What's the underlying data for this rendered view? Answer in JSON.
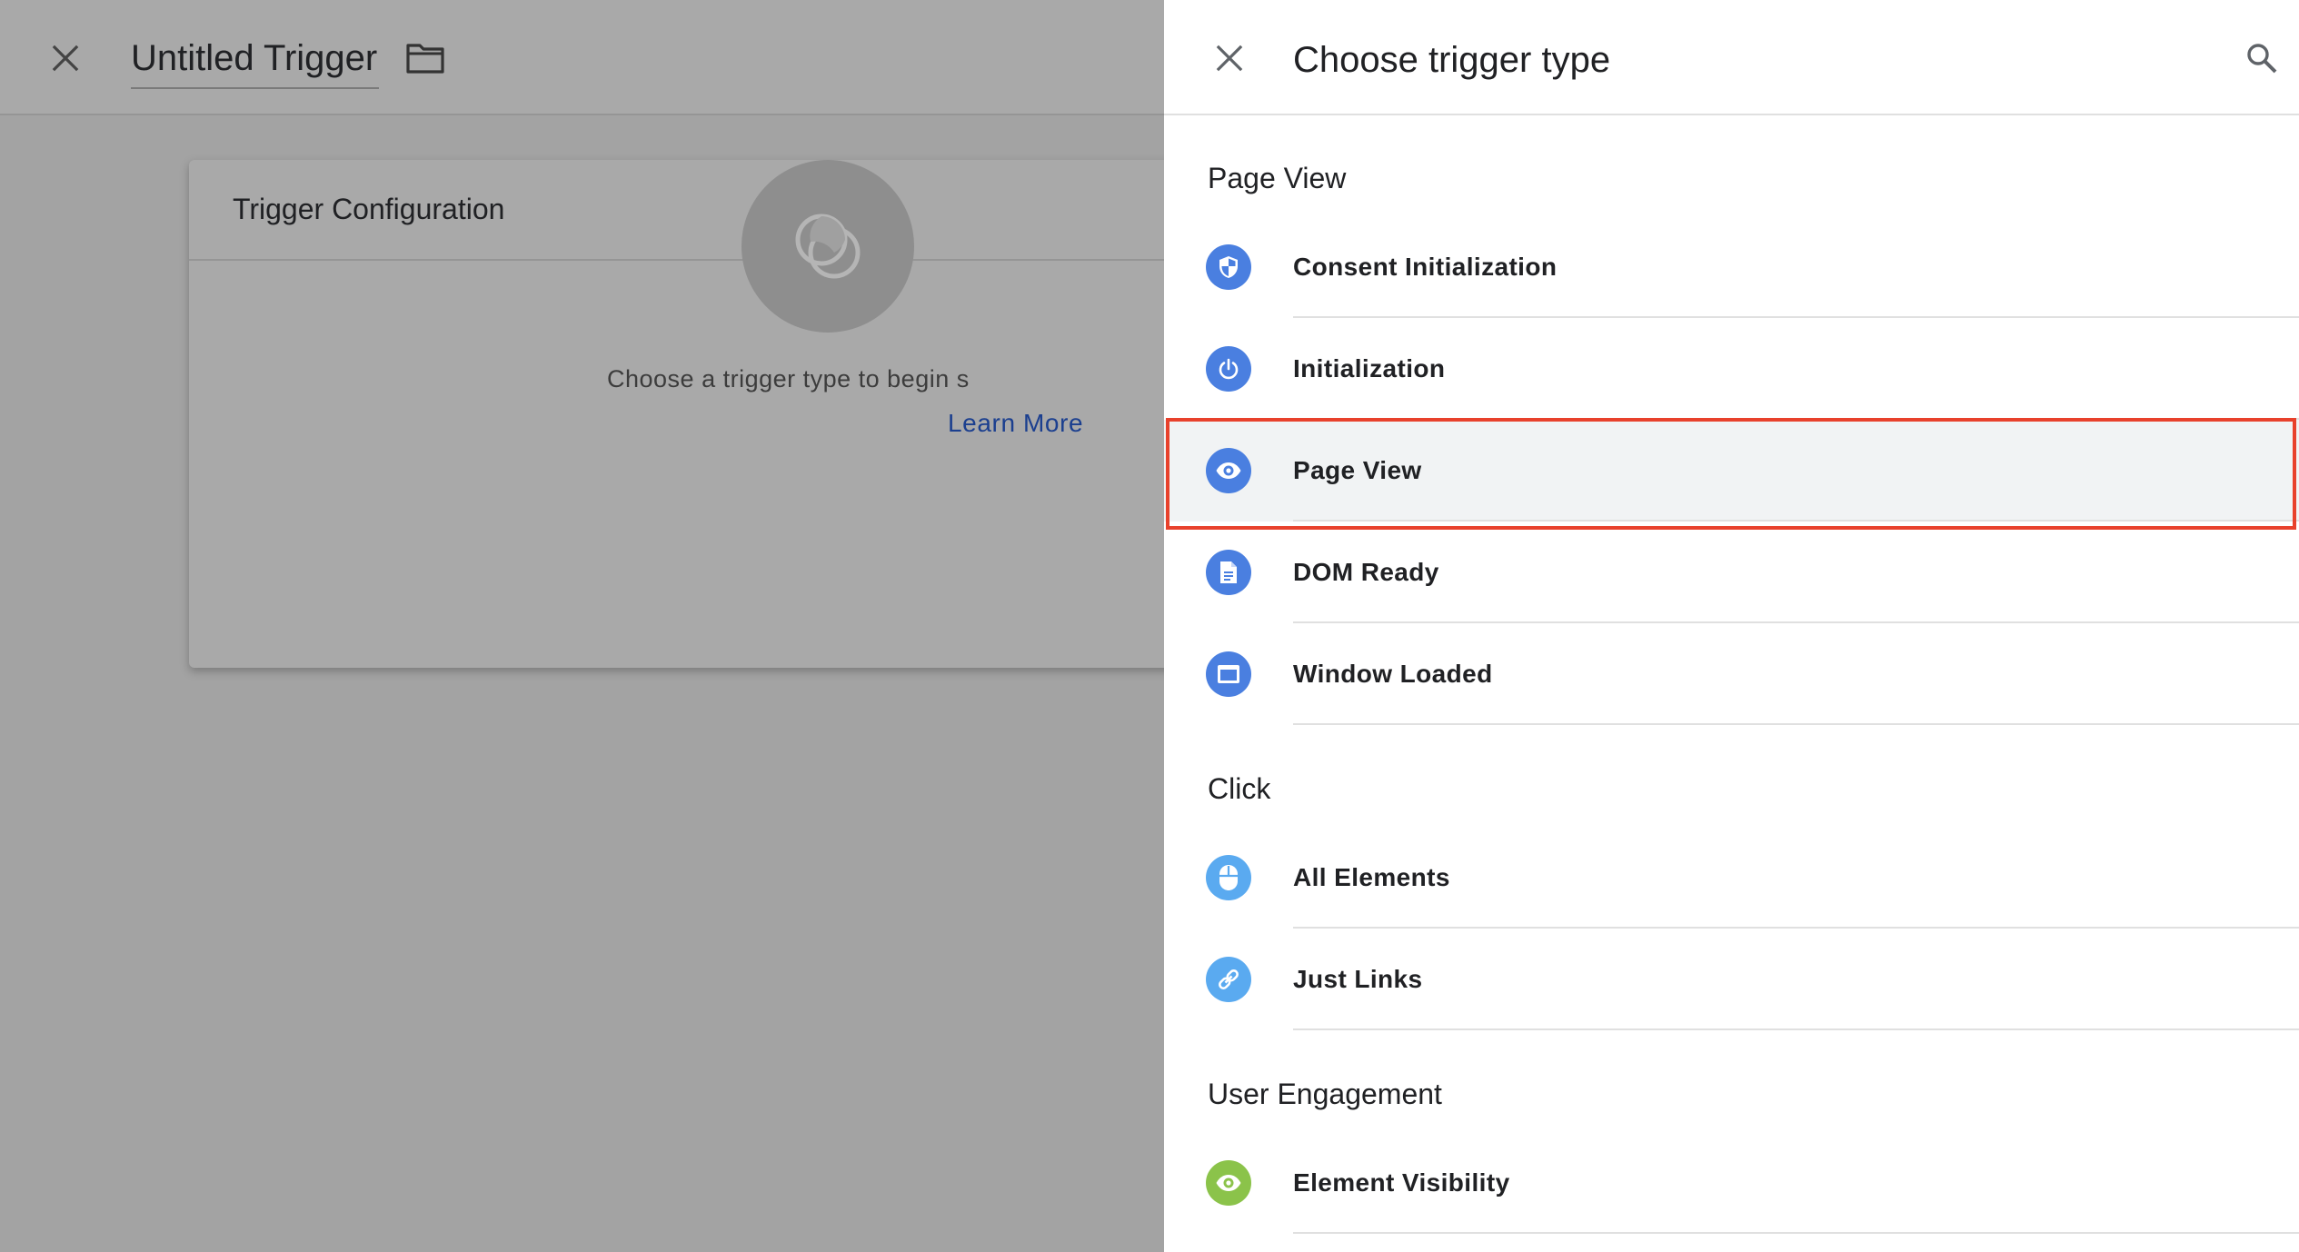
{
  "editor": {
    "title": "Untitled Trigger",
    "card_title": "Trigger Configuration",
    "hint": "Choose a trigger type to begin s",
    "learn_more": "Learn More"
  },
  "panel": {
    "title": "Choose trigger type",
    "sections": [
      {
        "title": "Page View",
        "items": [
          {
            "label": "Consent Initialization",
            "icon": "shield-icon"
          },
          {
            "label": "Initialization",
            "icon": "power-icon"
          },
          {
            "label": "Page View",
            "icon": "eye-icon",
            "selected": true
          },
          {
            "label": "DOM Ready",
            "icon": "document-icon"
          },
          {
            "label": "Window Loaded",
            "icon": "window-icon"
          }
        ]
      },
      {
        "title": "Click",
        "items": [
          {
            "label": "All Elements",
            "icon": "mouse-icon"
          },
          {
            "label": "Just Links",
            "icon": "link-icon"
          }
        ]
      },
      {
        "title": "User Engagement",
        "items": [
          {
            "label": "Element Visibility",
            "icon": "eye-icon"
          }
        ]
      }
    ]
  },
  "colors": {
    "icon_blue": "#4a7fe0",
    "icon_light_blue": "#5aaaf0",
    "icon_green": "#8bc34a",
    "highlight_red": "#e8412c",
    "link_blue": "#1b3f8f"
  }
}
